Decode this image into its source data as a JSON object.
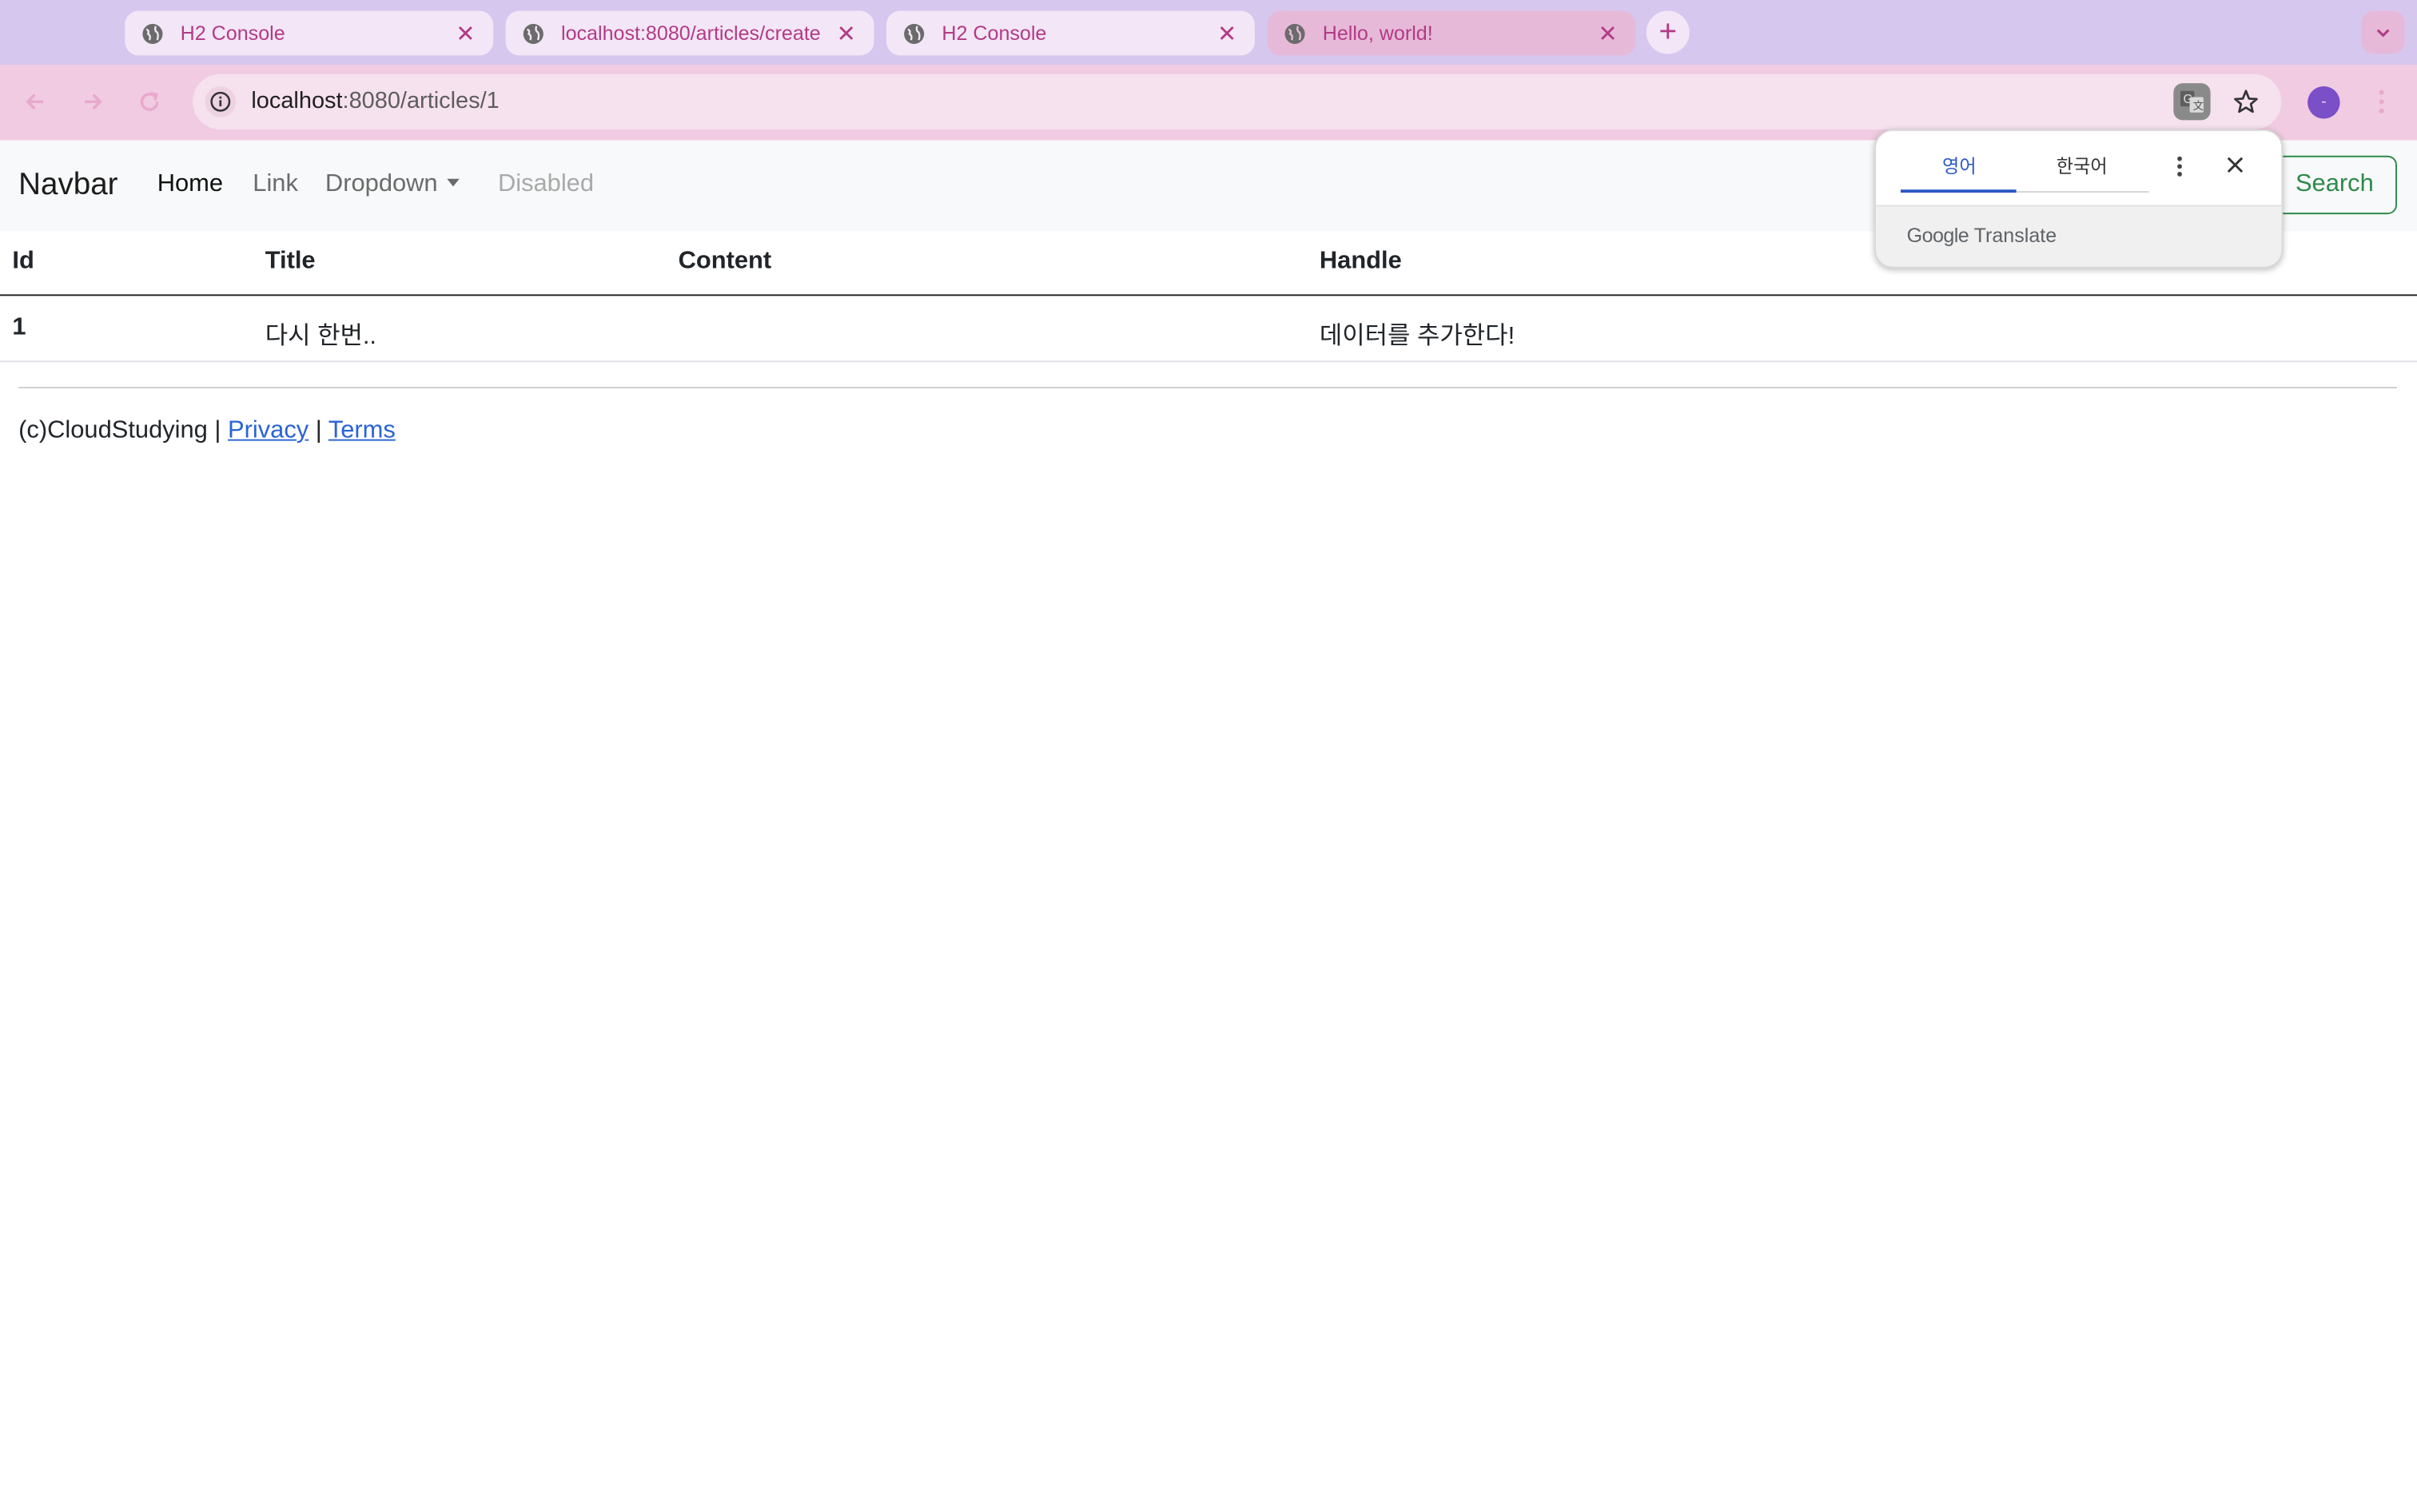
{
  "browser": {
    "tabs": [
      {
        "title": "H2 Console",
        "active": false
      },
      {
        "title": "localhost:8080/articles/create",
        "active": false
      },
      {
        "title": "H2 Console",
        "active": false
      },
      {
        "title": "Hello, world!",
        "active": true
      }
    ],
    "address": {
      "host": "localhost",
      "path": ":8080/articles/1"
    },
    "profile_initial": "-"
  },
  "navbar": {
    "brand": "Navbar",
    "items": [
      {
        "label": "Home",
        "state": "active"
      },
      {
        "label": "Link",
        "state": "normal"
      },
      {
        "label": "Dropdown",
        "state": "dropdown"
      },
      {
        "label": "Disabled",
        "state": "disabled"
      }
    ],
    "search_label": "Search"
  },
  "table": {
    "headers": [
      "Id",
      "Title",
      "Content",
      "Handle"
    ],
    "rows": [
      [
        "1",
        "다시 한번..",
        "",
        "데이터를 추가한다!"
      ]
    ]
  },
  "footer": {
    "text": "(c)CloudStudying |",
    "sep": "|",
    "privacy": "Privacy",
    "terms": "Terms"
  },
  "translate_popup": {
    "tabs": [
      "영어",
      "한국어"
    ],
    "brand_google": "Google",
    "brand_translate": "Translate"
  },
  "colors": {
    "tabstrip": "#d6c7ef",
    "toolbar": "#f0cbe2",
    "tab_text": "#b23a86",
    "search_green": "#2f8a4a",
    "link_blue": "#2a63d4"
  },
  "icons": [
    "globe-icon",
    "close-icon",
    "plus-icon",
    "chevron-down-icon",
    "back-arrow-icon",
    "forward-arrow-icon",
    "reload-icon",
    "info-icon",
    "translate-icon",
    "star-icon",
    "more-vert-icon"
  ]
}
